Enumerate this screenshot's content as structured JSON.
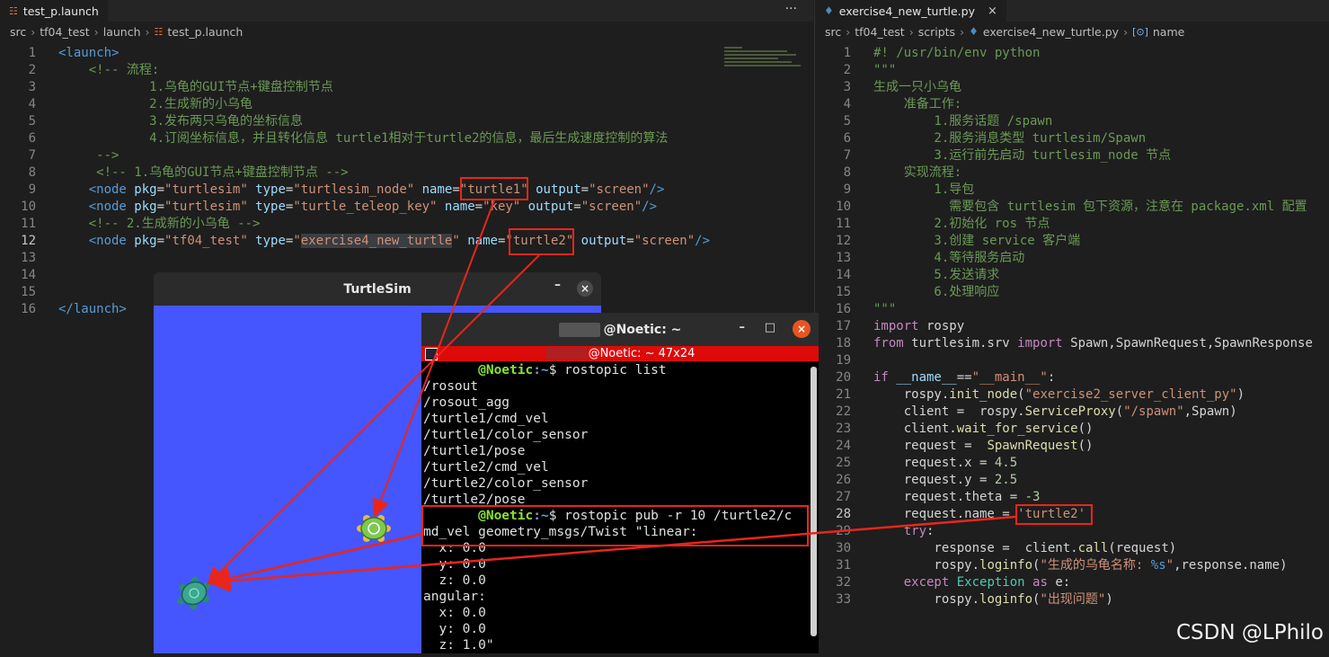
{
  "left_editor": {
    "tab": {
      "label": "test_p.launch",
      "actions": "···"
    },
    "breadcrumb": [
      "src",
      "tf04_test",
      "launch",
      "test_p.launch"
    ],
    "lines": [
      [
        {
          "t": "<launch>",
          "c": "c-tag"
        }
      ],
      [
        {
          "t": "    <!-- 流程:",
          "c": "c-com"
        }
      ],
      [
        {
          "t": "            1.乌龟的GUI节点+键盘控制节点",
          "c": "c-com"
        }
      ],
      [
        {
          "t": "            2.生成新的小乌龟",
          "c": "c-com"
        }
      ],
      [
        {
          "t": "            3.发布两只乌龟的坐标信息",
          "c": "c-com"
        }
      ],
      [
        {
          "t": "            4.订阅坐标信息，并且转化信息 turtle1相对于turtle2的信息，最后生成速度控制的算法",
          "c": "c-com"
        }
      ],
      [
        {
          "t": "     -->",
          "c": "c-com"
        }
      ],
      [
        {
          "t": "     <!-- 1.乌龟的GUI节点+键盘控制节点 -->",
          "c": "c-com"
        }
      ],
      [
        {
          "t": "    <node ",
          "c": "c-tag"
        },
        {
          "t": "pkg",
          "c": "c-attr"
        },
        {
          "t": "=",
          "c": "c-txt"
        },
        {
          "t": "\"turtlesim\"",
          "c": "c-str"
        },
        {
          "t": " type",
          "c": "c-attr"
        },
        {
          "t": "=",
          "c": "c-txt"
        },
        {
          "t": "\"turtlesim_node\"",
          "c": "c-str"
        },
        {
          "t": " name",
          "c": "c-attr"
        },
        {
          "t": "=",
          "c": "c-txt"
        },
        {
          "t": "\"turtle1\"",
          "c": "c-str"
        },
        {
          "t": " output",
          "c": "c-attr"
        },
        {
          "t": "=",
          "c": "c-txt"
        },
        {
          "t": "\"screen\"",
          "c": "c-str"
        },
        {
          "t": "/>",
          "c": "c-tag"
        }
      ],
      [
        {
          "t": "    <node ",
          "c": "c-tag"
        },
        {
          "t": "pkg",
          "c": "c-attr"
        },
        {
          "t": "=",
          "c": "c-txt"
        },
        {
          "t": "\"turtlesim\"",
          "c": "c-str"
        },
        {
          "t": " type",
          "c": "c-attr"
        },
        {
          "t": "=",
          "c": "c-txt"
        },
        {
          "t": "\"turtle_teleop_key\"",
          "c": "c-str"
        },
        {
          "t": " name",
          "c": "c-attr"
        },
        {
          "t": "=",
          "c": "c-txt"
        },
        {
          "t": "\"key\"",
          "c": "c-str"
        },
        {
          "t": " output",
          "c": "c-attr"
        },
        {
          "t": "=",
          "c": "c-txt"
        },
        {
          "t": "\"screen\"",
          "c": "c-str"
        },
        {
          "t": "/>",
          "c": "c-tag"
        }
      ],
      [
        {
          "t": "    <!-- 2.生成新的小乌龟 -->",
          "c": "c-com"
        }
      ],
      [
        {
          "t": "    <node ",
          "c": "c-tag"
        },
        {
          "t": "pkg",
          "c": "c-attr"
        },
        {
          "t": "=",
          "c": "c-txt"
        },
        {
          "t": "\"tf04_test\"",
          "c": "c-str"
        },
        {
          "t": " type",
          "c": "c-attr"
        },
        {
          "t": "=",
          "c": "c-txt"
        },
        {
          "t": "\"",
          "c": "c-str"
        },
        {
          "t": "exercise4_new_turtle",
          "c": "c-str hl-sel"
        },
        {
          "t": "\"",
          "c": "c-str"
        },
        {
          "t": " name",
          "c": "c-attr"
        },
        {
          "t": "=",
          "c": "c-txt"
        },
        {
          "t": "\"turtle2\"",
          "c": "c-str"
        },
        {
          "t": " output",
          "c": "c-attr"
        },
        {
          "t": "=",
          "c": "c-txt"
        },
        {
          "t": "\"screen\"",
          "c": "c-str"
        },
        {
          "t": "/>",
          "c": "c-tag"
        }
      ],
      [],
      [],
      [],
      [
        {
          "t": "</launch>",
          "c": "c-tag"
        }
      ]
    ]
  },
  "right_editor": {
    "tab": {
      "label": "exercise4_new_turtle.py",
      "close": "×"
    },
    "breadcrumb": [
      "src",
      "tf04_test",
      "scripts",
      "exercise4_new_turtle.py",
      "name"
    ],
    "lines": [
      [
        {
          "t": "#! /usr/bin/env python",
          "c": "c-com"
        }
      ],
      [
        {
          "t": "\"\"\"",
          "c": "c-com"
        }
      ],
      [
        {
          "t": "生成一只小乌龟",
          "c": "c-com"
        }
      ],
      [
        {
          "t": "    准备工作:",
          "c": "c-com"
        }
      ],
      [
        {
          "t": "        1.服务话题 /spawn",
          "c": "c-com"
        }
      ],
      [
        {
          "t": "        2.服务消息类型 turtlesim/Spawn",
          "c": "c-com"
        }
      ],
      [
        {
          "t": "        3.运行前先启动 turtlesim_node 节点",
          "c": "c-com"
        }
      ],
      [
        {
          "t": "    实现流程:",
          "c": "c-com"
        }
      ],
      [
        {
          "t": "        1.导包",
          "c": "c-com"
        }
      ],
      [
        {
          "t": "          需要包含 turtlesim 包下资源，注意在 package.xml 配置",
          "c": "c-com"
        }
      ],
      [
        {
          "t": "        2.初始化 ros 节点",
          "c": "c-com"
        }
      ],
      [
        {
          "t": "        3.创建 service 客户端",
          "c": "c-com"
        }
      ],
      [
        {
          "t": "        4.等待服务启动",
          "c": "c-com"
        }
      ],
      [
        {
          "t": "        5.发送请求",
          "c": "c-com"
        }
      ],
      [
        {
          "t": "        6.处理响应",
          "c": "c-com"
        }
      ],
      [
        {
          "t": "\"\"\"",
          "c": "c-com"
        }
      ],
      [
        {
          "t": "import",
          "c": "c-kw"
        },
        {
          "t": " rospy",
          "c": "c-txt"
        }
      ],
      [
        {
          "t": "from",
          "c": "c-kw"
        },
        {
          "t": " turtlesim.srv ",
          "c": "c-txt"
        },
        {
          "t": "import",
          "c": "c-kw"
        },
        {
          "t": " Spawn,SpawnRequest,SpawnResponse",
          "c": "c-txt"
        }
      ],
      [],
      [
        {
          "t": "if",
          "c": "c-kw"
        },
        {
          "t": " __name__",
          "c": "c-var"
        },
        {
          "t": "==",
          "c": "c-txt"
        },
        {
          "t": "\"__main__\"",
          "c": "c-str"
        },
        {
          "t": ":",
          "c": "c-txt"
        }
      ],
      [
        {
          "t": "    rospy.",
          "c": "c-txt"
        },
        {
          "t": "init_node",
          "c": "c-fn"
        },
        {
          "t": "(",
          "c": "c-txt"
        },
        {
          "t": "\"exercise2_server_client_py\"",
          "c": "c-str"
        },
        {
          "t": ")",
          "c": "c-txt"
        }
      ],
      [
        {
          "t": "    client = ",
          "c": "c-txt"
        },
        {
          "t": " rospy.",
          "c": "c-txt"
        },
        {
          "t": "ServiceProxy",
          "c": "c-fn"
        },
        {
          "t": "(",
          "c": "c-txt"
        },
        {
          "t": "\"/spawn\"",
          "c": "c-str"
        },
        {
          "t": ",Spawn)",
          "c": "c-txt"
        }
      ],
      [
        {
          "t": "    client.",
          "c": "c-txt"
        },
        {
          "t": "wait_for_service",
          "c": "c-fn"
        },
        {
          "t": "()",
          "c": "c-txt"
        }
      ],
      [
        {
          "t": "    request = ",
          "c": "c-txt"
        },
        {
          "t": " SpawnRequest",
          "c": "c-fn"
        },
        {
          "t": "()",
          "c": "c-txt"
        }
      ],
      [
        {
          "t": "    request.x = ",
          "c": "c-txt"
        },
        {
          "t": "4.5",
          "c": "c-num"
        }
      ],
      [
        {
          "t": "    request.y = ",
          "c": "c-txt"
        },
        {
          "t": "2.5",
          "c": "c-num"
        }
      ],
      [
        {
          "t": "    request.theta = ",
          "c": "c-txt"
        },
        {
          "t": "-3",
          "c": "c-num"
        }
      ],
      [
        {
          "t": "    request.name = ",
          "c": "c-txt"
        },
        {
          "t": "'turtle2'",
          "c": "c-str"
        }
      ],
      [
        {
          "t": "    try",
          "c": "c-kw"
        },
        {
          "t": ":",
          "c": "c-txt"
        }
      ],
      [
        {
          "t": "        response = ",
          "c": "c-txt"
        },
        {
          "t": " client.",
          "c": "c-txt"
        },
        {
          "t": "call",
          "c": "c-fn"
        },
        {
          "t": "(request)",
          "c": "c-txt"
        }
      ],
      [
        {
          "t": "        rospy.",
          "c": "c-txt"
        },
        {
          "t": "loginfo",
          "c": "c-fn"
        },
        {
          "t": "(",
          "c": "c-txt"
        },
        {
          "t": "\"生成的乌龟名称: ",
          "c": "c-str"
        },
        {
          "t": "%s",
          "c": "c-esc"
        },
        {
          "t": "\"",
          "c": "c-str"
        },
        {
          "t": ",response.name)",
          "c": "c-txt"
        }
      ],
      [
        {
          "t": "    except",
          "c": "c-kw"
        },
        {
          "t": " Exception",
          "c": "c-cls"
        },
        {
          "t": " as",
          "c": "c-kw"
        },
        {
          "t": " e:",
          "c": "c-txt"
        }
      ],
      [
        {
          "t": "        rospy.",
          "c": "c-txt"
        },
        {
          "t": "loginfo",
          "c": "c-fn"
        },
        {
          "t": "(",
          "c": "c-txt"
        },
        {
          "t": "\"出现问题\"",
          "c": "c-str"
        },
        {
          "t": ")",
          "c": "c-txt"
        }
      ]
    ]
  },
  "turtlesim": {
    "title": "TurtleSim",
    "minimize": "–",
    "close": "×"
  },
  "terminal": {
    "title": "@Noetic: ~",
    "subtitle": "@Noetic: ~ 47x24",
    "btn_min": "–",
    "btn_max": "□",
    "btn_close": "×",
    "lines": [
      {
        "prompt": "       @Noetic",
        "path": ":~",
        "cmd": "$ rostopic list"
      },
      {
        "text": "/rosout"
      },
      {
        "text": "/rosout_agg"
      },
      {
        "text": "/turtle1/cmd_vel"
      },
      {
        "text": "/turtle1/color_sensor"
      },
      {
        "text": "/turtle1/pose"
      },
      {
        "text": "/turtle2/cmd_vel"
      },
      {
        "text": "/turtle2/color_sensor"
      },
      {
        "text": "/turtle2/pose"
      },
      {
        "prompt": "       @Noetic",
        "path": ":~",
        "cmd": "$ rostopic pub -r 10 /turtle2/c"
      },
      {
        "text": "md_vel geometry_msgs/Twist \"linear:"
      },
      {
        "text": "  x: 0.0"
      },
      {
        "text": "  y: 0.0"
      },
      {
        "text": "  z: 0.0"
      },
      {
        "text": "angular:"
      },
      {
        "text": "  x: 0.0"
      },
      {
        "text": "  y: 0.0"
      },
      {
        "text": "  z: 1.0\""
      }
    ]
  },
  "watermark": "CSDN @LPhilo"
}
